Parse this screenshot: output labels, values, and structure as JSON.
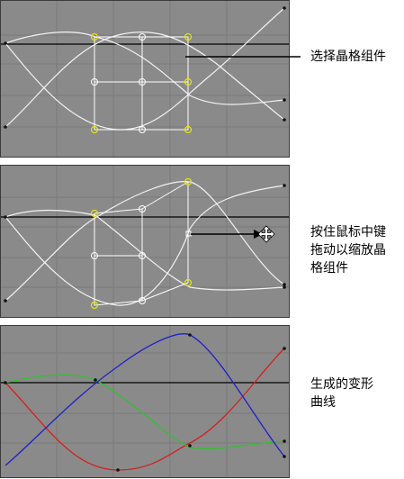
{
  "panels": [
    {
      "annotation": [
        "选择晶格组件"
      ]
    },
    {
      "annotation": [
        "按住鼠标中键",
        "拖动以缩放晶",
        "格组件"
      ]
    },
    {
      "annotation": [
        "生成的变形",
        "曲线"
      ]
    }
  ],
  "colors": {
    "viewport_bg": "#8a8a8a",
    "grid_line": "#7a7a7a",
    "curve_white": "#f2f2f2",
    "lattice": "#ffffff",
    "selected_point": "#e8e800",
    "axis_line": "#000000",
    "curve_red": "#d42020",
    "curve_green": "#30c030",
    "curve_blue": "#2020c8"
  },
  "icons": {
    "move_cursor": "four-way-arrow-icon"
  }
}
